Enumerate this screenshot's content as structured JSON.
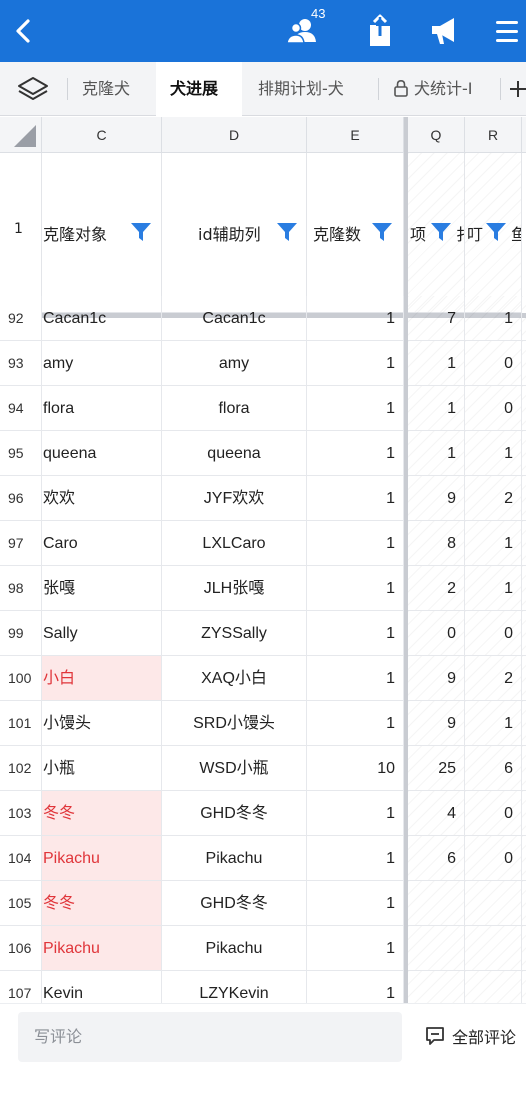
{
  "topbar": {
    "collaborator_count": "43",
    "icons": [
      "back-arrow-icon",
      "collaborators-icon",
      "share-upload-icon",
      "announcement-icon",
      "menu-icon"
    ],
    "color": "#1a73d9"
  },
  "tabs": {
    "items": [
      {
        "label": "克隆犬",
        "active": false
      },
      {
        "label": "犬进展",
        "active": true
      },
      {
        "label": "排期计划-犬",
        "active": false
      },
      {
        "label": "犬统计-I",
        "active": false,
        "locked": true
      }
    ]
  },
  "columns": {
    "letters": [
      "C",
      "D",
      "E",
      "Q",
      "R"
    ],
    "header_row_num": "1",
    "headers": [
      "克隆对象",
      "id辅助列",
      "克隆数",
      "项",
      "扌",
      "叮",
      "鱼"
    ]
  },
  "rows": [
    {
      "num": "92",
      "c": "Cacan1c",
      "d": "Cacan1c",
      "e": "1",
      "q": "7",
      "r": "1",
      "red": false
    },
    {
      "num": "93",
      "c": "amy",
      "d": "amy",
      "e": "1",
      "q": "1",
      "r": "0",
      "red": false
    },
    {
      "num": "94",
      "c": "flora",
      "d": "flora",
      "e": "1",
      "q": "1",
      "r": "0",
      "red": false
    },
    {
      "num": "95",
      "c": "queena",
      "d": "queena",
      "e": "1",
      "q": "1",
      "r": "1",
      "red": false
    },
    {
      "num": "96",
      "c": "欢欢",
      "d": "JYF欢欢",
      "e": "1",
      "q": "9",
      "r": "2",
      "red": false
    },
    {
      "num": "97",
      "c": "Caro",
      "d": "LXLCaro",
      "e": "1",
      "q": "8",
      "r": "1",
      "red": false
    },
    {
      "num": "98",
      "c": "张嘎",
      "d": "JLH张嘎",
      "e": "1",
      "q": "2",
      "r": "1",
      "red": false
    },
    {
      "num": "99",
      "c": "Sally",
      "d": "ZYSSally",
      "e": "1",
      "q": "0",
      "r": "0",
      "red": false
    },
    {
      "num": "100",
      "c": "小白",
      "d": "XAQ小白",
      "e": "1",
      "q": "9",
      "r": "2",
      "red": true
    },
    {
      "num": "101",
      "c": "小馒头",
      "d": "SRD小馒头",
      "e": "1",
      "q": "9",
      "r": "1",
      "red": false
    },
    {
      "num": "102",
      "c": "小瓶",
      "d": "WSD小瓶",
      "e": "10",
      "q": "25",
      "r": "6",
      "red": false
    },
    {
      "num": "103",
      "c": "冬冬",
      "d": "GHD冬冬",
      "e": "1",
      "q": "4",
      "r": "0",
      "red": true
    },
    {
      "num": "104",
      "c": "Pikachu",
      "d": "Pikachu",
      "e": "1",
      "q": "6",
      "r": "0",
      "red": true
    },
    {
      "num": "105",
      "c": "冬冬",
      "d": "GHD冬冬",
      "e": "1",
      "q": "",
      "r": "",
      "red": true
    },
    {
      "num": "106",
      "c": "Pikachu",
      "d": "Pikachu",
      "e": "1",
      "q": "",
      "r": "",
      "red": true
    },
    {
      "num": "107",
      "c": "Kevin",
      "d": "LZYKevin",
      "e": "1",
      "q": "",
      "r": "",
      "red": false
    }
  ],
  "bottombar": {
    "comment_placeholder": "写评论",
    "all_comments_label": "全部评论"
  }
}
